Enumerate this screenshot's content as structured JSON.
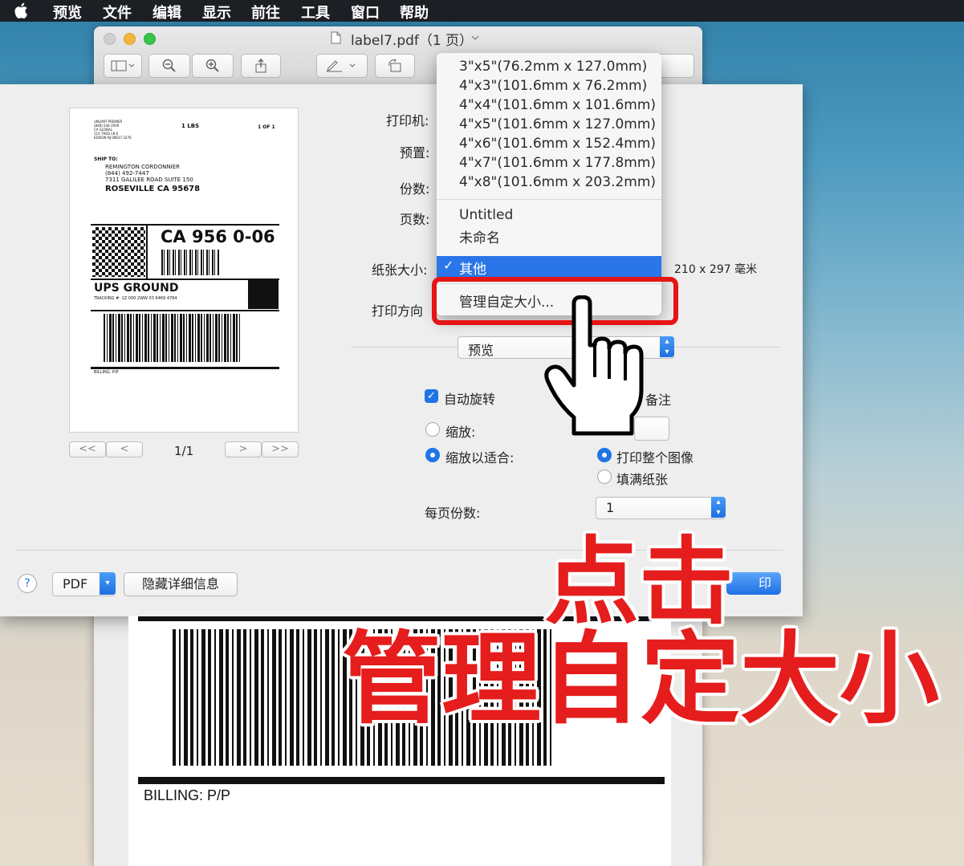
{
  "menubar": {
    "items": [
      "预览",
      "文件",
      "编辑",
      "显示",
      "前往",
      "工具",
      "窗口",
      "帮助"
    ]
  },
  "window": {
    "title": "label7.pdf（1 页）"
  },
  "label_preview": {
    "small_lines": [
      "UNLIMIT PREMIER",
      "(848) 244-2000",
      "CA GLOBAL",
      "114 THED LN E",
      "EDISON NJ 08837-3276"
    ],
    "weight": "1 LBS",
    "count": "1 OF 1",
    "ship_to": "SHIP TO:",
    "recipient_name": "REMINGTON CORDONNIER",
    "recipient_phone": "(844) 492-7447",
    "recipient_street": "7311 GALILEE ROAD SUITE 150",
    "recipient_city": "ROSEVILLE  CA 95678",
    "routing": "CA 956 0-06",
    "service": "UPS GROUND",
    "tracking": "TRACKING #: 1Z 000 2WW 03 6469 4784",
    "billing": "BILLING: P/P"
  },
  "page_nav": {
    "indicator": "1/1",
    "first": "<<",
    "prev": "<",
    "next": ">",
    "last": ">>"
  },
  "form": {
    "printer_label": "打印机:",
    "preset_label": "预置:",
    "copies_label": "份数:",
    "pages_label": "页数:",
    "paper_size_label": "纸张大小:",
    "paper_size_dims": "210 x 297 毫米",
    "orientation_label": "打印方向",
    "app_select": "预览",
    "auto_rotate": "自动旋转",
    "show_notes": "备注",
    "scale": "缩放:",
    "scale_to_fit": "缩放以适合:",
    "print_entire_image": "打印整个图像",
    "fill_paper": "填满纸张",
    "copies_per_page_label": "每页份数:",
    "copies_per_page_value": "1"
  },
  "footer": {
    "help": "?",
    "pdf": "PDF",
    "hide_details": "隐藏详细信息",
    "print": "印"
  },
  "dropdown": {
    "sizes": [
      "3\"x5\"(76.2mm x 127.0mm)",
      "4\"x3\"(101.6mm x 76.2mm)",
      "4\"x4\"(101.6mm x 101.6mm)",
      "4\"x5\"(101.6mm x 127.0mm)",
      "4\"x6\"(101.6mm x 152.4mm)",
      "4\"x7\"(101.6mm x 177.8mm)",
      "4\"x8\"(101.6mm x 203.2mm)"
    ],
    "untitled": "Untitled",
    "unnamed": "未命名",
    "selected": "其他",
    "manage": "管理自定大小..."
  },
  "overlay": {
    "line1": "点击",
    "line2": "管理自定大小"
  },
  "colors": {
    "accent": "#1f74e6",
    "highlight_red": "#e61414",
    "overlay_text": "#e51d1d"
  }
}
